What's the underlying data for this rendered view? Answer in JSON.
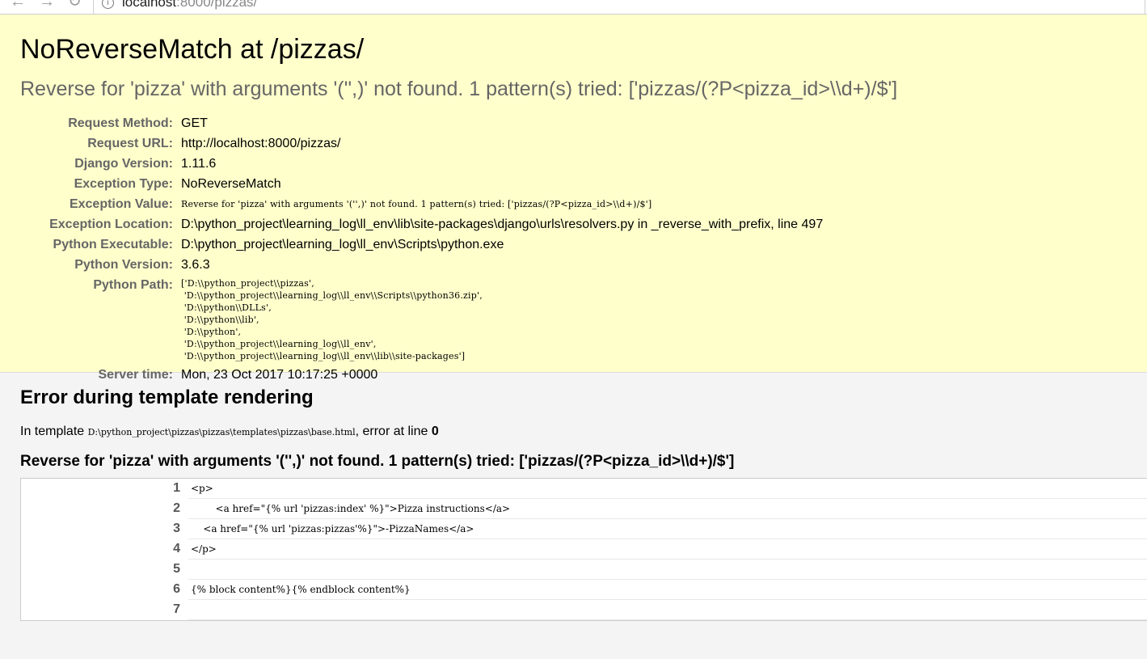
{
  "browser": {
    "back_icon": "arrow-left-icon",
    "forward_icon": "arrow-right-icon",
    "reload_icon": "reload-icon",
    "address_host": "localhost",
    "address_rest": ":8000/pizzas/"
  },
  "summary": {
    "title": "NoReverseMatch at /pizzas/",
    "exception_value_heading": "Reverse for 'pizza' with arguments '('',)' not found. 1 pattern(s) tried: ['pizzas/(?P<pizza_id>\\\\d+)/$']",
    "rows": [
      {
        "label": "Request Method:",
        "value": "GET"
      },
      {
        "label": "Request URL:",
        "value": "http://localhost:8000/pizzas/"
      },
      {
        "label": "Django Version:",
        "value": "1.11.6"
      },
      {
        "label": "Exception Type:",
        "value": "NoReverseMatch"
      },
      {
        "label": "Exception Value:",
        "value": "Reverse for 'pizza' with arguments '('',)' not found. 1 pattern(s) tried: ['pizzas/(?P<pizza_id>\\\\d+)/$']"
      },
      {
        "label": "Exception Location:",
        "value": "D:\\python_project\\learning_log\\ll_env\\lib\\site-packages\\django\\urls\\resolvers.py in _reverse_with_prefix, line 497"
      },
      {
        "label": "Python Executable:",
        "value": "D:\\python_project\\learning_log\\ll_env\\Scripts\\python.exe"
      },
      {
        "label": "Python Version:",
        "value": "3.6.3"
      },
      {
        "label": "Python Path:",
        "value": "['D:\\\\python_project\\\\pizzas',\n 'D:\\\\python_project\\\\learning_log\\\\ll_env\\\\Scripts\\\\python36.zip',\n 'D:\\\\python\\\\DLLs',\n 'D:\\\\python\\\\lib',\n 'D:\\\\python',\n 'D:\\\\python_project\\\\learning_log\\\\ll_env',\n 'D:\\\\python_project\\\\learning_log\\\\ll_env\\\\lib\\\\site-packages']"
      },
      {
        "label": "Server time:",
        "value": "Mon, 23 Oct 2017 10:17:25 +0000"
      }
    ]
  },
  "template": {
    "heading": "Error during template rendering",
    "in_template_prefix": "In template ",
    "template_path": "D:\\python_project\\pizzas\\pizzas\\templates\\pizzas\\base.html",
    "error_at_line_text": ", error at line ",
    "error_line": "0",
    "error_message": "Reverse for 'pizza' with arguments '('',)' not found. 1 pattern(s) tried: ['pizzas/(?P<pizza_id>\\\\d+)/$']",
    "source_lines": [
      {
        "num": "1",
        "code": "<p>"
      },
      {
        "num": "2",
        "code": "        <a href=\"{% url 'pizzas:index' %}\">Pizza instructions</a>"
      },
      {
        "num": "3",
        "code": "    <a href=\"{% url 'pizzas:pizzas'%}\">-PizzaNames</a>"
      },
      {
        "num": "4",
        "code": "</p>"
      },
      {
        "num": "5",
        "code": ""
      },
      {
        "num": "6",
        "code": "{% block content%}{% endblock content%}"
      },
      {
        "num": "7",
        "code": ""
      }
    ]
  }
}
